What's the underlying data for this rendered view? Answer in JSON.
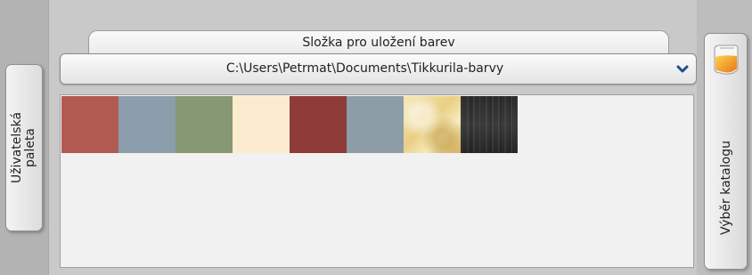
{
  "left_tab": {
    "label_line1": "Uživatelská",
    "label_line2": "paleta"
  },
  "folder_tab": {
    "label": "Složka pro uložení barev"
  },
  "folder_select": {
    "value": "C:\\Users\\Petrmat\\Documents\\Tikkurila-barvy",
    "icon": "chevron-down-icon"
  },
  "palette": {
    "swatches": [
      {
        "color": "#b15a52"
      },
      {
        "color": "#8c9eab"
      },
      {
        "color": "#869874"
      },
      {
        "color": "#fbecd0"
      },
      {
        "color": "#8e3b3a"
      },
      {
        "color": "#8c9da7"
      },
      {
        "color": "#e9cf84",
        "texture": "light-stone"
      },
      {
        "color": "#2b2b2b",
        "texture": "dark-wood"
      }
    ]
  },
  "catalog_tab": {
    "label": "Výběr katalogu",
    "icon": "paint-catalog-icon"
  },
  "colors": {
    "accent_chevron": "#1e4f8c"
  }
}
